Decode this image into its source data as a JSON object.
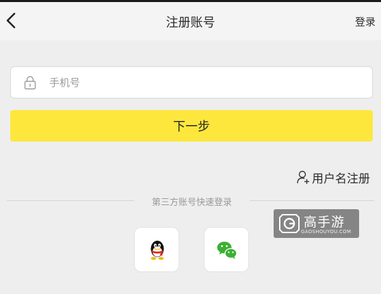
{
  "navbar": {
    "title": "注册账号",
    "login_label": "登录"
  },
  "phone_field": {
    "placeholder": "手机号",
    "value": ""
  },
  "next_button": {
    "label": "下一步"
  },
  "username_register": {
    "label": "用户名注册"
  },
  "third_party": {
    "divider_text": "第三方账号快速登录",
    "options": [
      "qq-icon",
      "wechat-icon"
    ]
  },
  "watermark": {
    "main": "高手游",
    "sub": "GAOSHOUYOU.COM"
  },
  "colors": {
    "accent": "#fde73d",
    "background": "#eeeeee",
    "wechat_green": "#3cb034",
    "qq_black": "#111111"
  }
}
